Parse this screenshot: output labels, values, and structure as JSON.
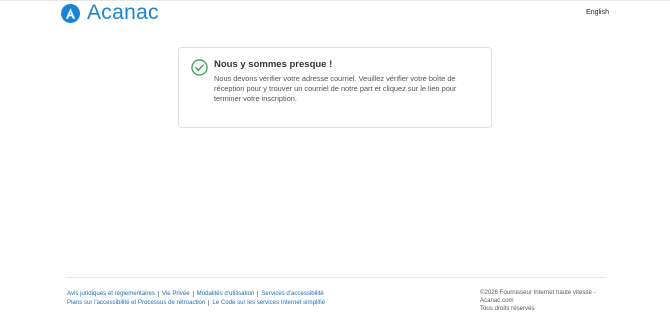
{
  "header": {
    "brand": "Acanac",
    "language_link": "English"
  },
  "card": {
    "title": "Nous y sommes presque !",
    "message": "Nous devons vérifier votre adresse courriel. Veuillez vérifier votre boîte de réception pour y trouver un courriel de notre part et cliquez sur le lien pour terminer votre inscription."
  },
  "footer": {
    "links_row1": [
      "Avis juridiques et réglementaires",
      "Vie Privée",
      "Modalités d'utilisation",
      "Services d'accessibilité"
    ],
    "links_row2": [
      "Plans sur l'accessibilité et Processus de rétroaction",
      "Le Code sur les services Internet simplifié"
    ],
    "copyright": "©2026 Fournisseur Internet haute vitesse - Acanac.com",
    "rights": "Tous droits réservés"
  },
  "colors": {
    "brand": "#1a84d4",
    "success_check": "#3e9b57",
    "link": "#1f6fb8"
  }
}
